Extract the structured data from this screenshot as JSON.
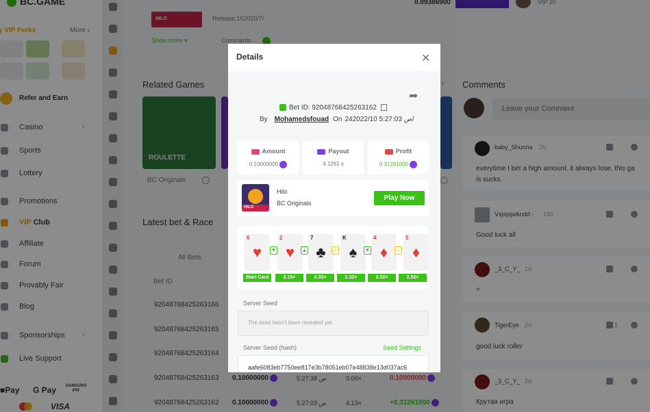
{
  "header": {
    "top_value": "0.89386900",
    "top_vip": "VIP 20"
  },
  "sidebar": {
    "logo": "BC.GAME",
    "perks_title": "y VIP Perks",
    "perks_more": "More",
    "refer": "Refer and Earn",
    "items": [
      {
        "label": "Casino",
        "chev": true
      },
      {
        "label": "Sports",
        "chev": false
      },
      {
        "label": "Lottery",
        "chev": false
      },
      {
        "label": "Promotions",
        "chev": false
      },
      {
        "label": "Affiliate",
        "chev": false
      },
      {
        "label": "Forum",
        "chev": false
      },
      {
        "label": "Provably Fair",
        "chev": false
      },
      {
        "label": "Blog",
        "chev": false
      },
      {
        "label": "Sponsorships",
        "chev": true
      },
      {
        "label": "Live Support",
        "chev": false
      }
    ],
    "vip_club": {
      "vip": "VIP",
      "club": " Club"
    },
    "payments": [
      "Pay",
      "G Pay",
      "SAMSUNG pay",
      "VISA"
    ]
  },
  "main": {
    "hilo_thumb": "HILO",
    "release": "Release:102020/7/",
    "show_more": "Show more",
    "comments_toggle": "Comments",
    "related_title": "Related Games",
    "roulette_label": "ROULETTE",
    "bc_originals": "BC Originals",
    "latest_title": "Latest bet & Race",
    "all_bets": "All Bets",
    "bet_id_head": "Bet ID",
    "rows": [
      {
        "id": "92048768425263166"
      },
      {
        "id": "92048768425263165"
      },
      {
        "id": "92048768425263164"
      },
      {
        "id": "92048768425263163",
        "amount": "0.10000000",
        "time": "5:27:38 ص",
        "mult": "0.00×",
        "profit": "0.10000000"
      },
      {
        "id": "92048768425263162",
        "amount": "0.10000000",
        "time": "5:27:03 ص",
        "mult": "4.13×",
        "profit": "+0.31261000"
      }
    ]
  },
  "comments": {
    "title": "Comments",
    "placeholder": "Leave your Comment",
    "items": [
      {
        "name": "baby_Shunna",
        "time": "2h",
        "text": "everytime I bet a high amount. it always lose. this ga",
        "text2": "is sucks.",
        "likes": ""
      },
      {
        "name": "Vsjsjsjwkndd -",
        "time": "18h",
        "text": "Good luck all",
        "likes": ""
      },
      {
        "name": "_3_C_Y_",
        "time": "1d",
        "text": "=",
        "likes": ""
      },
      {
        "name": "TigerEye",
        "time": "2d",
        "text": "good luck roller",
        "likes": "1"
      },
      {
        "name": "_3_C_Y_",
        "time": "2d",
        "text": "Крутая игра",
        "likes": ""
      }
    ]
  },
  "dialog": {
    "title": "Details",
    "bet_id": "Bet ID: 92048768425263162",
    "by": "By",
    "user": "Mohamedsfouad",
    "on": "On",
    "date": "24ص 5:27:03 2022/10/",
    "stats": [
      {
        "label": "Amount",
        "value": "0.10000000",
        "color": "#e0477b"
      },
      {
        "label": "Payout",
        "value": "4.1261 x",
        "color": "#7b3fe4"
      },
      {
        "label": "Profit",
        "value": "0.31261000",
        "color": "#e04747"
      }
    ],
    "game": {
      "name": "Hilo",
      "provider": "BC Originals",
      "play": "Play Now",
      "thumb_label": "HILO"
    },
    "cards": [
      {
        "rank": "6",
        "suit": "♥",
        "color": "#e33b3b"
      },
      {
        "rank": "2",
        "suit": "♥",
        "color": "#e33b3b"
      },
      {
        "rank": "7",
        "suit": "♣",
        "color": "#222222"
      },
      {
        "rank": "K",
        "suit": "♠",
        "color": "#222222"
      },
      {
        "rank": "4",
        "suit": "♦",
        "color": "#e33b3b"
      },
      {
        "rank": "5",
        "suit": "♦",
        "color": "#e33b3b"
      }
    ],
    "arrows": [
      "▼",
      "▲",
      "»",
      "▼",
      "»"
    ],
    "multipliers": [
      "Start Card",
      "2.15×",
      "2.32×",
      "2.32×",
      "2.52×",
      "2.52×"
    ],
    "server_seed_label": "Server Seed",
    "server_seed_value": "The seed hasn't been revealed yet.",
    "hash_label": "Server Seed (hash)",
    "seed_settings": "Seed Settings",
    "hash_value": "aafe6083eb7750ee817e3b78051eb07e48838e13d037ac6"
  }
}
